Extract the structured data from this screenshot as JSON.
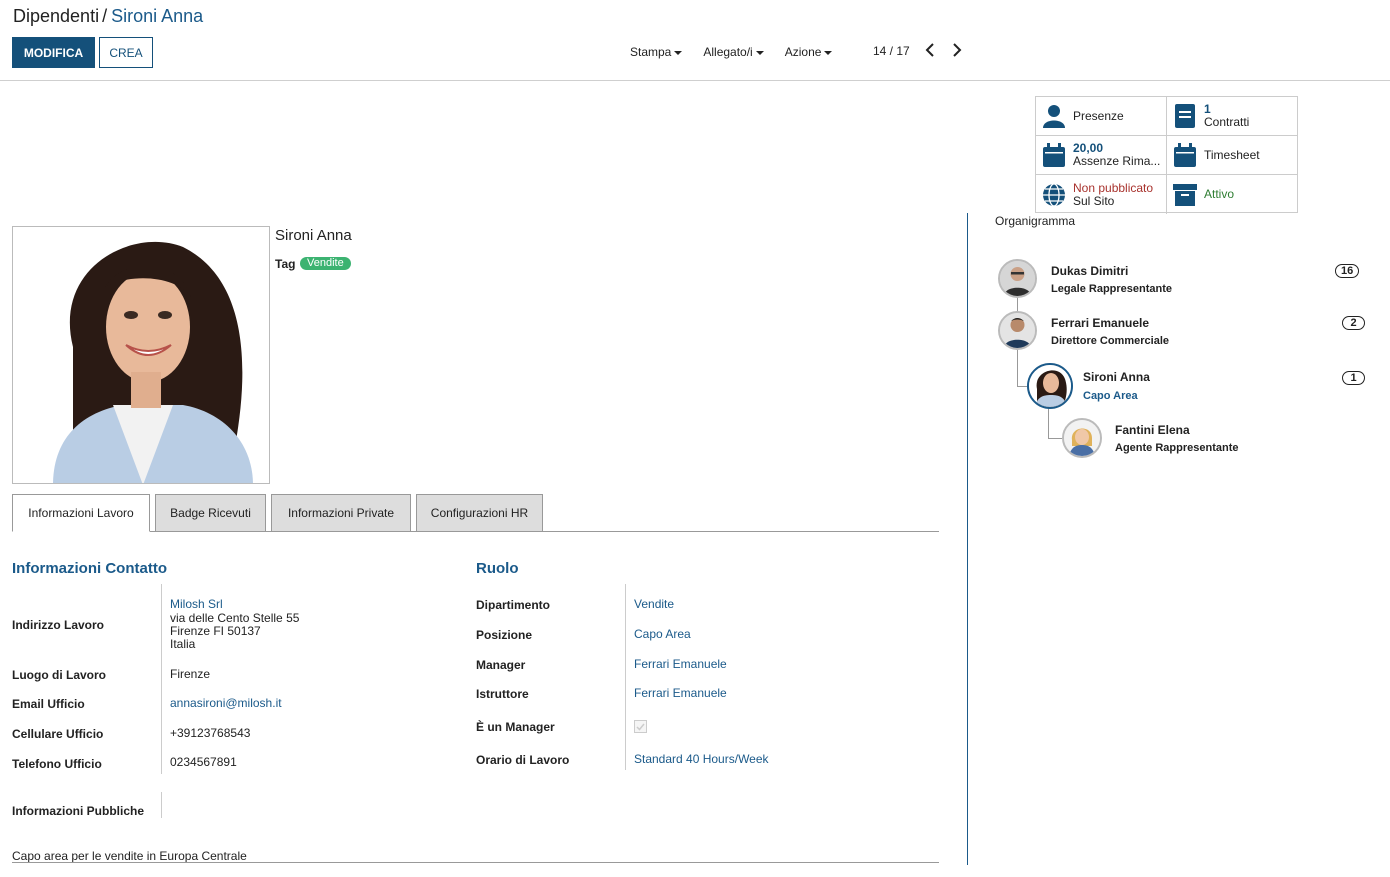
{
  "breadcrumb": {
    "parent": "Dipendenti",
    "separator": "/",
    "current": "Sironi Anna"
  },
  "toolbar": {
    "edit_label": "MODIFICA",
    "create_label": "CREA"
  },
  "actions": {
    "print": "Stampa",
    "attachment": "Allegato/i",
    "action": "Azione"
  },
  "pager": {
    "value": "14 / 17"
  },
  "smart_buttons": {
    "attendance": {
      "label": "Presenze"
    },
    "contracts": {
      "count": "1",
      "label": "Contratti"
    },
    "leaves": {
      "count": "20,00",
      "label": "Assenze Rima..."
    },
    "timesheet": {
      "label": "Timesheet"
    },
    "website": {
      "status": "Non pubblicato",
      "label": "Sul Sito"
    },
    "archive": {
      "label": "Attivo"
    },
    "colors": {
      "icon": "#14507a",
      "unpublished": "#a8322d",
      "active": "#2e7d32"
    }
  },
  "employee": {
    "name": "Sironi Anna",
    "tag_label": "Tag",
    "tag": "Vendite"
  },
  "tabs": [
    "Informazioni Lavoro",
    "Badge Ricevuti",
    "Informazioni Private",
    "Configurazioni HR"
  ],
  "contact": {
    "title": "Informazioni Contatto",
    "address_label": "Indirizzo Lavoro",
    "address_company": "Milosh Srl",
    "address_street": "via delle Cento Stelle 55",
    "address_city": "Firenze FI 50137",
    "address_country": "Italia",
    "location_label": "Luogo di Lavoro",
    "location": "Firenze",
    "email_label": "Email Ufficio",
    "email": "annasironi@milosh.it",
    "mobile_label": "Cellulare Ufficio",
    "mobile": "+39123768543",
    "phone_label": "Telefono Ufficio",
    "phone": "0234567891",
    "public_info_label": "Informazioni Pubbliche",
    "public_info": "Capo area per le vendite in Europa Centrale"
  },
  "role": {
    "title": "Ruolo",
    "department_label": "Dipartimento",
    "department": "Vendite",
    "position_label": "Posizione",
    "position": "Capo Area",
    "manager_label": "Manager",
    "manager": "Ferrari Emanuele",
    "coach_label": "Istruttore",
    "coach": "Ferrari Emanuele",
    "is_manager_label": "È un Manager",
    "schedule_label": "Orario di Lavoro",
    "schedule": "Standard 40 Hours/Week"
  },
  "org_chart": {
    "title": "Organigramma",
    "nodes": [
      {
        "name": "Dukas Dimitri",
        "job": "Legale Rappresentante",
        "count": "16"
      },
      {
        "name": "Ferrari Emanuele",
        "job": "Direttore Commerciale",
        "count": "2"
      },
      {
        "name": "Sironi Anna",
        "job": "Capo Area",
        "count": "1"
      },
      {
        "name": "Fantini Elena",
        "job": "Agente Rappresentante"
      }
    ]
  }
}
